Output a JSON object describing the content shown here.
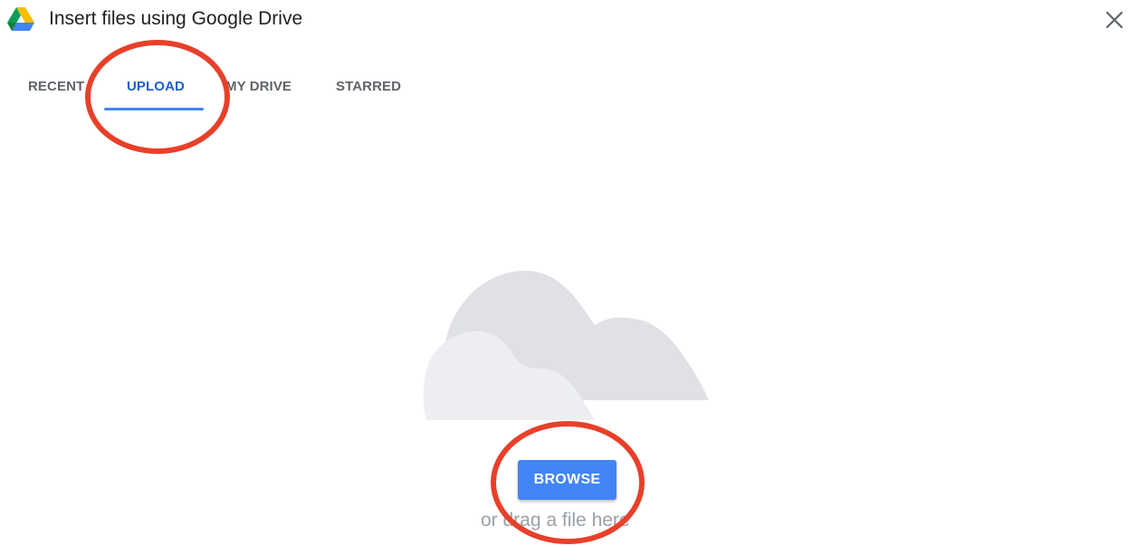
{
  "dialog": {
    "title": "Insert files using Google Drive",
    "logo_icon": "google-drive-icon",
    "close_icon": "close-icon"
  },
  "tabs": [
    {
      "label": "RECENT",
      "active": false
    },
    {
      "label": "UPLOAD",
      "active": true
    },
    {
      "label": "MY DRIVE",
      "active": false
    },
    {
      "label": "STARRED",
      "active": false
    }
  ],
  "upload": {
    "illustration_icon": "cloud-icon",
    "browse_label": "BROWSE",
    "drag_hint": "or drag a file here"
  },
  "colors": {
    "accent": "#4285f4",
    "active_tab_text": "#1a5fcf",
    "annotation_circle": "#e8402a",
    "cloud_back": "#dfe1e5",
    "cloud_front": "#eceef1"
  }
}
